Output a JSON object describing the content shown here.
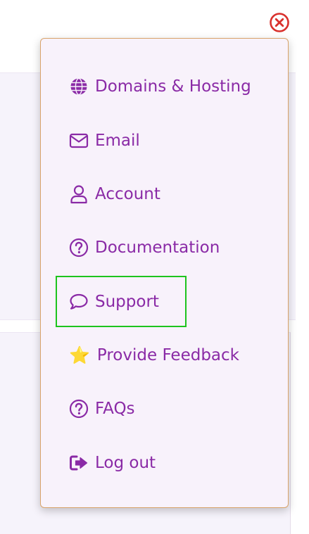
{
  "menu": {
    "items": [
      {
        "label": "Domains & Hosting",
        "icon": "globe-icon"
      },
      {
        "label": "Email",
        "icon": "envelope-icon"
      },
      {
        "label": "Account",
        "icon": "user-icon"
      },
      {
        "label": "Documentation",
        "icon": "question-circle-icon"
      },
      {
        "label": "Support",
        "icon": "speech-bubble-icon",
        "highlighted": true
      },
      {
        "label": "Provide Feedback",
        "icon": "star-icon"
      },
      {
        "label": "FAQs",
        "icon": "question-circle-icon"
      },
      {
        "label": "Log out",
        "icon": "sign-out-icon"
      }
    ]
  },
  "colors": {
    "accent": "#8a2aa6",
    "close": "#d9302c",
    "menu_background": "#f8f2fb",
    "menu_border": "#d9a36a",
    "highlight": "#1ec41e",
    "star": "#f5c518"
  }
}
